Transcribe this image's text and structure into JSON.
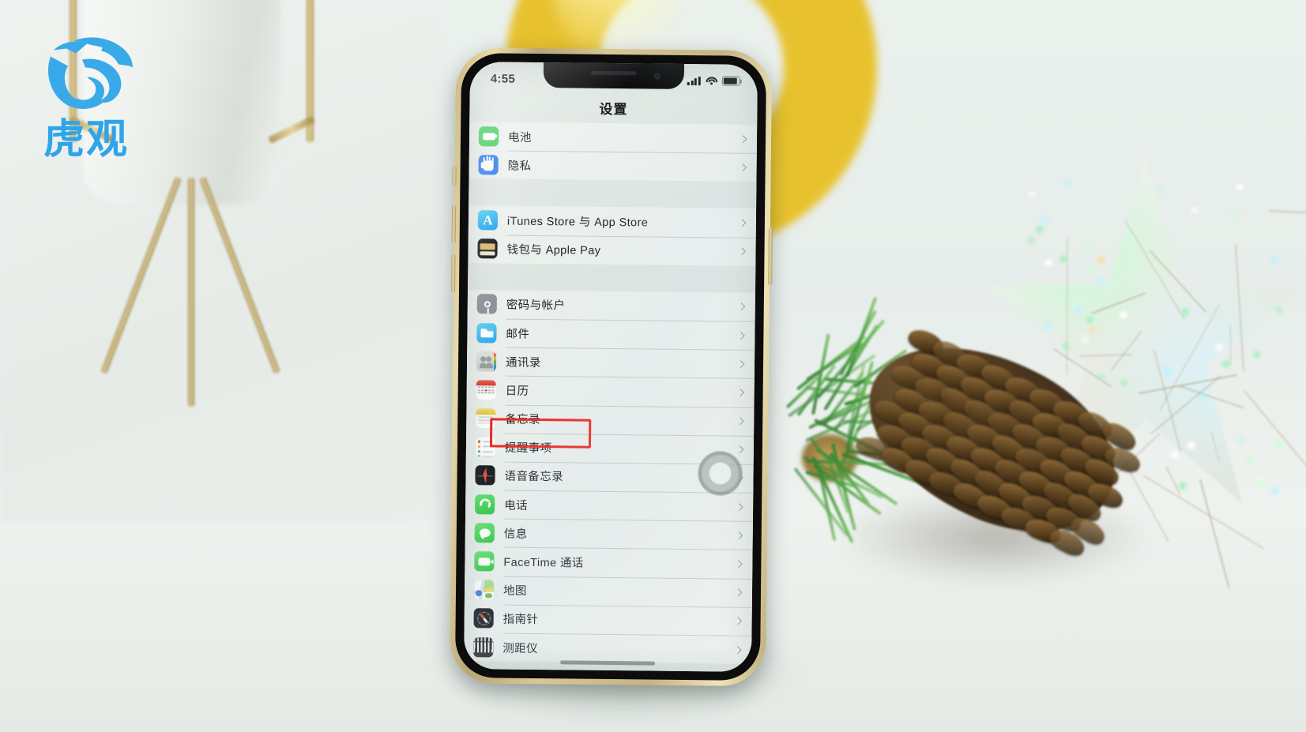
{
  "watermark": {
    "brand": "虎观",
    "logo_icon": "tiger-swirl-logo",
    "color": "#2fa4e8"
  },
  "scene": {
    "description": "iPhone held upright on a white table with a white ceramic planter on brass tripod at left, a glossy yellow ring ornament behind, a pine branch, a large pine cone and a glittery star at right",
    "objects": [
      "white-planter",
      "brass-tripod",
      "yellow-ring-ornament",
      "pine-branch",
      "pine-cone",
      "glitter-star"
    ]
  },
  "phone": {
    "status_bar": {
      "time": "4:55",
      "icons": [
        "cellular-signal-icon",
        "wifi-icon",
        "battery-icon"
      ],
      "battery_level": 88
    },
    "nav_title": "设置",
    "assistive_touch": "assistive-touch-button",
    "home_indicator": "home-indicator",
    "highlighted_row": "通讯录",
    "highlight_color": "#ee2119",
    "groups": [
      {
        "rows": [
          {
            "label": "电池",
            "icon": "battery-app-icon",
            "chevron": "chevron-right-icon"
          },
          {
            "label": "隐私",
            "icon": "privacy-hand-icon",
            "chevron": "chevron-right-icon"
          }
        ]
      },
      {
        "rows": [
          {
            "label": "iTunes Store 与 App Store",
            "icon": "app-store-icon",
            "chevron": "chevron-right-icon"
          },
          {
            "label": "钱包与 Apple Pay",
            "icon": "wallet-icon",
            "chevron": "chevron-right-icon"
          }
        ]
      },
      {
        "rows": [
          {
            "label": "密码与帐户",
            "icon": "passwords-key-icon",
            "chevron": "chevron-right-icon"
          },
          {
            "label": "邮件",
            "icon": "mail-icon",
            "chevron": "chevron-right-icon"
          },
          {
            "label": "通讯录",
            "icon": "contacts-icon",
            "chevron": "chevron-right-icon",
            "highlighted": true
          },
          {
            "label": "日历",
            "icon": "calendar-icon",
            "chevron": "chevron-right-icon"
          },
          {
            "label": "备忘录",
            "icon": "notes-icon",
            "chevron": "chevron-right-icon"
          },
          {
            "label": "提醒事项",
            "icon": "reminders-icon",
            "chevron": "chevron-right-icon"
          },
          {
            "label": "语音备忘录",
            "icon": "voice-memos-icon",
            "chevron": "chevron-right-icon"
          },
          {
            "label": "电话",
            "icon": "phone-icon",
            "chevron": "chevron-right-icon"
          },
          {
            "label": "信息",
            "icon": "messages-icon",
            "chevron": "chevron-right-icon"
          },
          {
            "label": "FaceTime 通话",
            "icon": "facetime-icon",
            "chevron": "chevron-right-icon"
          },
          {
            "label": "地图",
            "icon": "maps-icon",
            "chevron": "chevron-right-icon"
          },
          {
            "label": "指南针",
            "icon": "compass-icon",
            "chevron": "chevron-right-icon"
          },
          {
            "label": "测距仪",
            "icon": "measure-icon",
            "chevron": "chevron-right-icon"
          }
        ]
      }
    ]
  }
}
